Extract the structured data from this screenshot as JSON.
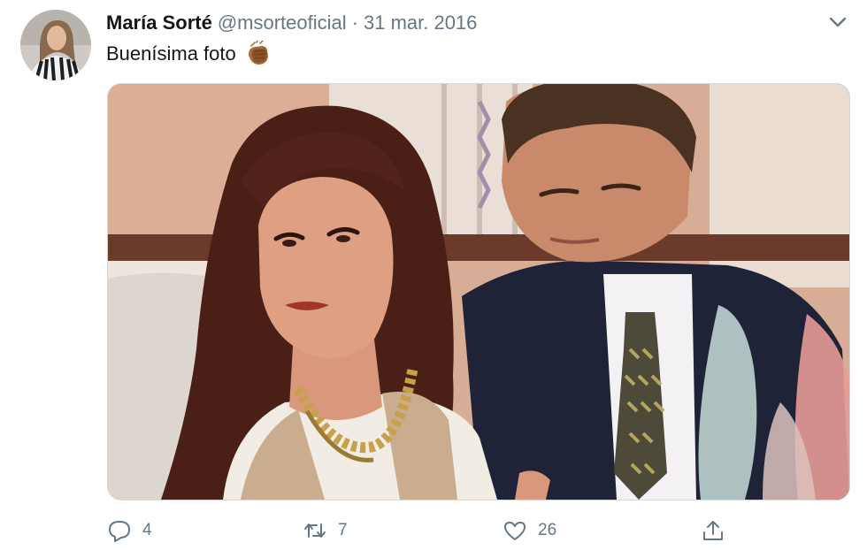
{
  "tweet": {
    "author_name": "María Sorté",
    "author_handle": "@msorteoficial",
    "separator": "·",
    "date": "31 mar. 2016",
    "text": "Buenísima foto",
    "emoji_icon": "clapping-hands-icon"
  },
  "actions": {
    "reply_count": "4",
    "retweet_count": "7",
    "like_count": "26"
  },
  "colors": {
    "muted": "#657786",
    "text": "#14171a",
    "border": "#cfd9de"
  }
}
